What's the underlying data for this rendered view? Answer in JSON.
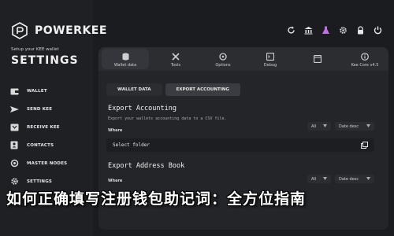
{
  "brand": {
    "name": "POWERKEE"
  },
  "sidebar": {
    "caption": "Setup your KEE wallet",
    "title": "SETTINGS",
    "items": [
      {
        "label": "WALLET",
        "icon": "wallet-icon"
      },
      {
        "label": "SEND KEE",
        "icon": "send-icon"
      },
      {
        "label": "RECEIVE KEE",
        "icon": "receive-icon"
      },
      {
        "label": "CONTACTS",
        "icon": "contacts-icon"
      },
      {
        "label": "MASTER NODES",
        "icon": "master-nodes-icon"
      },
      {
        "label": "SETTINGS",
        "icon": "gear-icon"
      }
    ]
  },
  "top_icons": [
    "refresh-icon",
    "bank-icon",
    "flask-icon",
    "settings-icon",
    "lock-icon",
    "power-icon"
  ],
  "tabs": [
    {
      "label": "Wallet data",
      "icon": "database-icon"
    },
    {
      "label": "Tools",
      "icon": "tools-icon"
    },
    {
      "label": "Options",
      "icon": "options-icon"
    },
    {
      "label": "Debug",
      "icon": "debug-icon"
    },
    {
      "label": "",
      "icon": "window-icon"
    },
    {
      "label": "Kee Core v4.5",
      "icon": "info-icon"
    }
  ],
  "subtabs": [
    {
      "label": "WALLET DATA"
    },
    {
      "label": "EXPORT ACCOUNTING"
    }
  ],
  "export_accounting": {
    "title": "Export Accounting",
    "description": "Export your wallets accounting data to a CSV file.",
    "where_label": "Where",
    "filter_value": "All",
    "sort_value": "Date desc",
    "folder_value": "Select folder"
  },
  "export_address_book": {
    "title": "Export Address Book",
    "where_label": "Where",
    "filter_value": "All",
    "sort_value": "Date desc"
  },
  "overlay": {
    "title": "如何正确填写注册钱包助记词：全方位指南"
  },
  "colors": {
    "background": "#1a1c20",
    "panel": "#232529",
    "accent": "#ffffff"
  }
}
